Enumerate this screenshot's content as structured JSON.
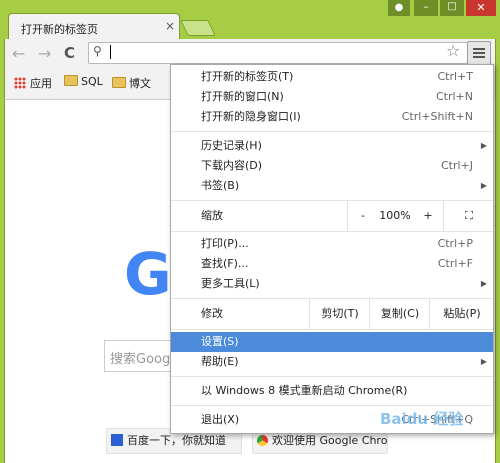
{
  "window": {
    "tab_title": "打开新的标签页",
    "tab_close": "×",
    "user_icon": "user-icon",
    "minimize": "–",
    "maximize": "□",
    "close": "✕"
  },
  "toolbar": {
    "back": "←",
    "forward": "→",
    "reload": "C",
    "omnibox_value": "",
    "search_icon": "🔍",
    "star": "☆"
  },
  "bookmarks": {
    "apps": "应用",
    "items": [
      "SQL",
      "博文"
    ]
  },
  "page": {
    "logo_letter": "G",
    "search_placeholder": "搜索Goog",
    "tiles": [
      "百度一下，你就知道",
      "欢迎使用 Google Chro"
    ]
  },
  "menu": {
    "items": {
      "new_tab": {
        "label": "打开新的标签页(T)",
        "shortcut": "Ctrl+T"
      },
      "new_window": {
        "label": "打开新的窗口(N)",
        "shortcut": "Ctrl+N"
      },
      "incognito": {
        "label": "打开新的隐身窗口(I)",
        "shortcut": "Ctrl+Shift+N"
      },
      "history": {
        "label": "历史记录(H)"
      },
      "downloads": {
        "label": "下载内容(D)",
        "shortcut": "Ctrl+J"
      },
      "bookmarks": {
        "label": "书签(B)"
      },
      "zoom": {
        "label": "缩放",
        "minus": "-",
        "value": "100%",
        "plus": "+",
        "fullscreen": "⛶"
      },
      "print": {
        "label": "打印(P)...",
        "shortcut": "Ctrl+P"
      },
      "find": {
        "label": "查找(F)...",
        "shortcut": "Ctrl+F"
      },
      "more_tools": {
        "label": "更多工具(L)"
      },
      "edit": {
        "label": "修改",
        "cut": "剪切(T)",
        "copy": "复制(C)",
        "paste": "粘贴(P)"
      },
      "settings": {
        "label": "设置(S)"
      },
      "help": {
        "label": "帮助(E)"
      },
      "relaunch": {
        "label": "以 Windows 8 模式重新启动 Chrome(R)"
      },
      "exit": {
        "label": "退出(X)",
        "shortcut": "Ctrl+Shift+Q"
      }
    },
    "highlight_color": "#4c8bd9"
  },
  "watermark": "Baidu 经验"
}
